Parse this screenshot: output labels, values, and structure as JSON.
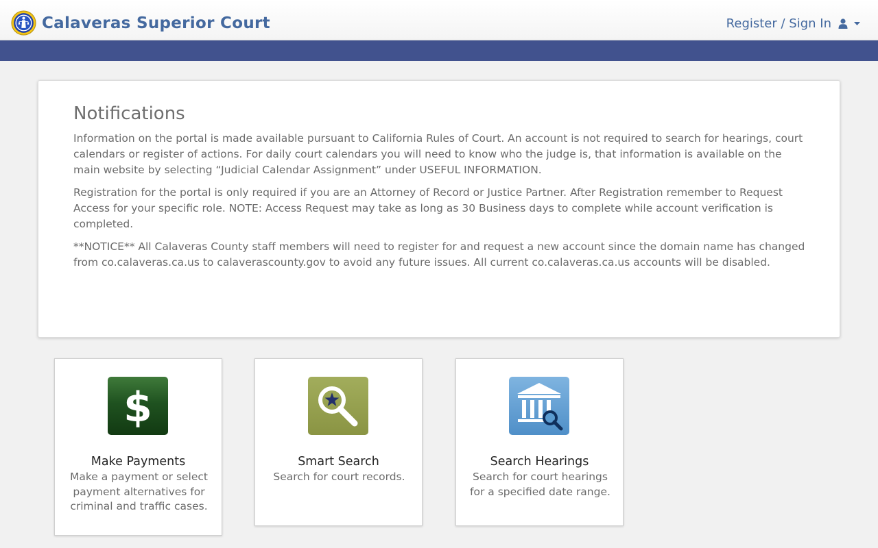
{
  "header": {
    "title": "Calaveras Superior Court",
    "signin_label": "Register / Sign In",
    "seal_icon": "court-seal-icon",
    "user_icon": "user-icon",
    "caret_icon": "caret-down-icon"
  },
  "notifications": {
    "title": "Notifications",
    "paragraphs": [
      "Information on the portal is made available pursuant to California Rules of Court. An account is not required to search for hearings, court calendars or register of actions. For daily court calendars you will need to know who the judge is, that information is available on the main website by selecting “Judicial Calendar Assignment” under USEFUL INFORMATION.",
      "Registration for the portal is only required if you are an Attorney of Record or Justice Partner. After Registration remember to Request Access for your specific role. NOTE: Access Request may take as long as 30 Business days to complete while account verification is completed.",
      "**NOTICE** All Calaveras County staff members will need to register for and request a new account since the domain name has changed from co.calaveras.ca.us to calaverascounty.gov to avoid any future issues. All current co.calaveras.ca.us accounts will be disabled."
    ]
  },
  "tiles": [
    {
      "title": "Make Payments",
      "description": "Make a payment or select payment alternatives for criminal and traffic cases.",
      "icon": "dollar-icon"
    },
    {
      "title": "Smart Search",
      "description": "Search for court records.",
      "icon": "smart-search-icon"
    },
    {
      "title": "Search Hearings",
      "description": "Search for court hearings for a specified date range.",
      "icon": "courthouse-search-icon"
    }
  ],
  "colors": {
    "brand_blue": "#44699f",
    "bar_blue": "#41528e",
    "payments_green": "#1d4d1b",
    "smart_search_olive": "#94a14c",
    "hearings_blue": "#5b9bd0"
  }
}
